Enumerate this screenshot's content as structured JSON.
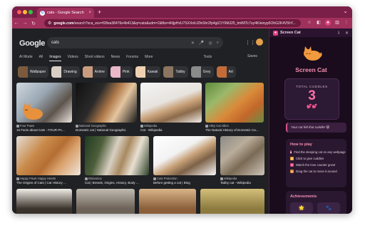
{
  "browser": {
    "tab_title": "cats - Google Search",
    "url_prefix": "google.com",
    "url_rest": "/search?sca_esv=f28ea38476e4b413&q=cats&udm=2&fbs=AIIjpHxU7SXXniUZfeShr2fp4giZ1Y6MJ25_tmWITc7uy4KIeioyp5OhG2K4V5hY...",
    "new_tab_glyph": "+",
    "menu_glyph": "⌄"
  },
  "google": {
    "logo": "Google",
    "query": "cats",
    "tabs": [
      "AI Mode",
      "All",
      "Images",
      "Videos",
      "Short videos",
      "News",
      "Forums",
      "More"
    ],
    "active_tab": "Images",
    "tools": "Tools",
    "saves": "Saves",
    "chips": [
      "Wallpaper",
      "Drawing",
      "Anime",
      "Pink",
      "Kawaii",
      "Tabby",
      "Grey",
      "Art"
    ],
    "results": [
      {
        "source": "Four Paws",
        "caption": "15 Facts about Cats - FOUR PA..."
      },
      {
        "source": "National Geographic",
        "caption": "Domestic cat | National Geographic"
      },
      {
        "source": "Wikipedia",
        "caption": "Cat - Wikipedia"
      },
      {
        "source": "Alley Cat Allies",
        "caption": "The Natural History of Domestic Ca..."
      },
      {
        "source": "Happy Paws Happy Hearts",
        "caption": "The Origins of Cats | Cat History ..."
      },
      {
        "source": "Britannica",
        "caption": "Cat | Breeds, Origins, History, Body ..."
      },
      {
        "source": "Cats Protection",
        "caption": "Before getting a cat | Blog"
      },
      {
        "source": "Wikipedia",
        "caption": "Tabby cat - Wikipedia"
      }
    ]
  },
  "panel": {
    "header_title": "Screen Cat",
    "title": "Screen Cat",
    "cuddles_label": "TOTAL CUDDLES",
    "cuddles_count": "3",
    "hearts": "💕💕",
    "message": "Your cat felt that cuddle! 😸",
    "howto_title": "How to play",
    "howto_items": [
      "Find the sleeping cat on any webpage",
      "Click to give cuddles",
      "Watch the love counter grow!",
      "Drag the cat to move it around"
    ],
    "achievements_title": "Achievements",
    "badges": [
      "🌟",
      "🐾"
    ]
  },
  "colors": {
    "accent": "#f48fb1",
    "chrome": "#a0305c",
    "panel_bg": "#1a0c1d"
  }
}
